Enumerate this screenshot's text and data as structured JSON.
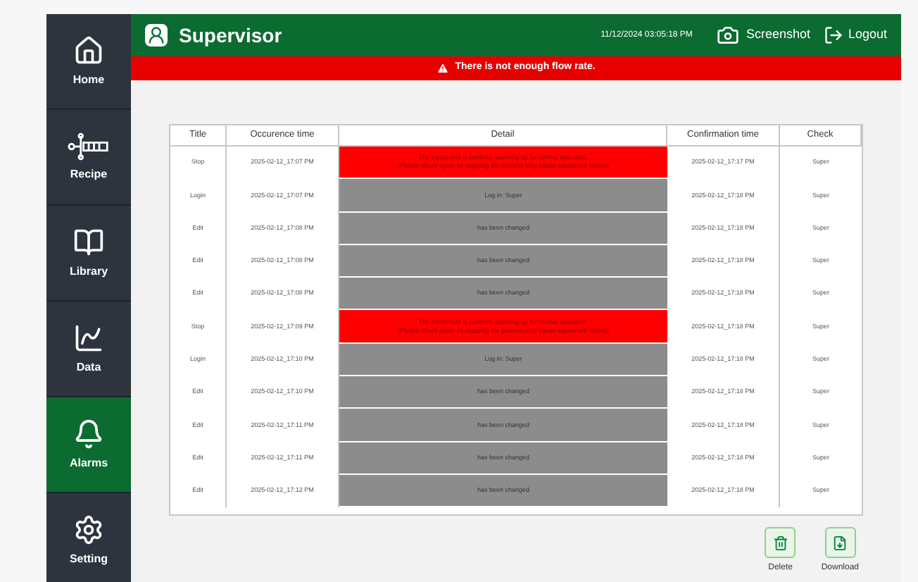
{
  "sidebar": {
    "items": [
      {
        "label": "Home",
        "kind": "home",
        "selected": false
      },
      {
        "label": "Recipe",
        "kind": "recipe",
        "selected": false
      },
      {
        "label": "Library",
        "kind": "library",
        "selected": false
      },
      {
        "label": "Data",
        "kind": "data",
        "selected": false
      },
      {
        "label": "Alarms",
        "kind": "alarms",
        "selected": true
      },
      {
        "label": "Setting",
        "kind": "setting",
        "selected": false
      }
    ]
  },
  "header": {
    "user": "Supervisor",
    "datetime": "11/12/2024 03:05:18 PM",
    "screenshot": "Screenshot",
    "logout": "Logout"
  },
  "alert": {
    "message": "There is not enough flow rate."
  },
  "table": {
    "columns": [
      "Title",
      "Occurence time",
      "Detail",
      "Confirmation time",
      "Check"
    ],
    "rows": [
      {
        "kind": "alarm",
        "title": "Stop",
        "occurence": "2025-02-12_17:07 PM",
        "detail": [
          "The equipment is currently warming up for normal operation.",
          "(Please check again as stopping the process may cause equipment issues)"
        ],
        "confirmation": "2025-02-12_17:17 PM",
        "check": "Super"
      },
      {
        "kind": "event",
        "title": "Login",
        "occurence": "2025-02-12_17:07 PM",
        "detail": [
          "Log in: Super"
        ],
        "confirmation": "2025-02-12_17:18 PM",
        "check": "Super"
      },
      {
        "kind": "event",
        "title": "Edit",
        "occurence": "2025-02-12_17:08 PM",
        "detail": [
          "has been changed"
        ],
        "confirmation": "2025-02-12_17:18 PM",
        "check": "Super"
      },
      {
        "kind": "event",
        "title": "Edit",
        "occurence": "2025-02-12_17:08 PM",
        "detail": [
          "has been changed"
        ],
        "confirmation": "2025-02-12_17:18 PM",
        "check": "Super"
      },
      {
        "kind": "event",
        "title": "Edit",
        "occurence": "2025-02-12_17:08 PM",
        "detail": [
          "has been changed"
        ],
        "confirmation": "2025-02-12_17:18 PM",
        "check": "Super"
      },
      {
        "kind": "alarm",
        "title": "Stop",
        "occurence": "2025-02-12_17:09 PM",
        "detail": [
          "The equipment is currently warming up for normal operation.",
          "(Please check again as stopping the process may cause equipment issues)"
        ],
        "confirmation": "2025-02-12_17:18 PM",
        "check": "Super"
      },
      {
        "kind": "event",
        "title": "Login",
        "occurence": "2025-02-12_17:10 PM",
        "detail": [
          "Log in: Super"
        ],
        "confirmation": "2025-02-12_17:18 PM",
        "check": "Super"
      },
      {
        "kind": "event",
        "title": "Edit",
        "occurence": "2025-02-12_17:10 PM",
        "detail": [
          "has been changed"
        ],
        "confirmation": "2025-02-12_17:18 PM",
        "check": "Super"
      },
      {
        "kind": "event",
        "title": "Edit",
        "occurence": "2025-02-12_17:11 PM",
        "detail": [
          "has been changed"
        ],
        "confirmation": "2025-02-12_17:18 PM",
        "check": "Super"
      },
      {
        "kind": "event",
        "title": "Edit",
        "occurence": "2025-02-12_17:11 PM",
        "detail": [
          "has been changed"
        ],
        "confirmation": "2025-02-12_17:18 PM",
        "check": "Super"
      },
      {
        "kind": "event",
        "title": "Edit",
        "occurence": "2025-02-12_17:12 PM",
        "detail": [
          "has been changed"
        ],
        "confirmation": "2025-02-12_17:18 PM",
        "check": "Super"
      }
    ]
  },
  "actions": [
    {
      "kind": "delete",
      "label": "Delete"
    },
    {
      "kind": "download",
      "label": "Download"
    }
  ]
}
